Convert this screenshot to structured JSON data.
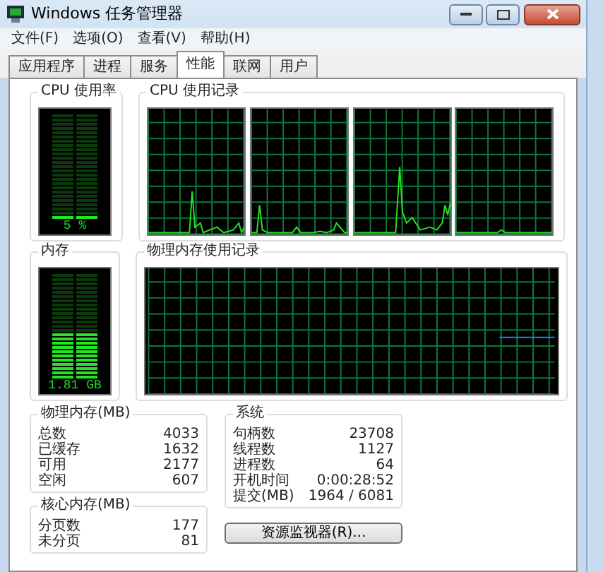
{
  "window": {
    "title": "Windows 任务管理器"
  },
  "menu": [
    "文件(F)",
    "选项(O)",
    "查看(V)",
    "帮助(H)"
  ],
  "tabs": [
    {
      "label": "应用程序",
      "selected": false
    },
    {
      "label": "进程",
      "selected": false
    },
    {
      "label": "服务",
      "selected": false
    },
    {
      "label": "性能",
      "selected": true
    },
    {
      "label": "联网",
      "selected": false
    },
    {
      "label": "用户",
      "selected": false
    }
  ],
  "cpu_usage": {
    "title": "CPU 使用率",
    "level": 0.05,
    "reading": "5 %"
  },
  "cpu_history": {
    "title": "CPU 使用记录"
  },
  "memory": {
    "title": "内存",
    "level": 0.45,
    "reading": "1.81 GB"
  },
  "memory_history": {
    "title": "物理内存使用记录"
  },
  "physical_memory": {
    "title": "物理内存(MB)",
    "rows": [
      {
        "label": "总数",
        "value": "4033"
      },
      {
        "label": "已缓存",
        "value": "1632"
      },
      {
        "label": "可用",
        "value": "2177"
      },
      {
        "label": "空闲",
        "value": "607"
      }
    ]
  },
  "kernel_memory": {
    "title": "核心内存(MB)",
    "rows": [
      {
        "label": "分页数",
        "value": "177"
      },
      {
        "label": "未分页",
        "value": "81"
      }
    ]
  },
  "system": {
    "title": "系统",
    "rows": [
      {
        "label": "句柄数",
        "value": "23708"
      },
      {
        "label": "线程数",
        "value": "1127"
      },
      {
        "label": "进程数",
        "value": "64"
      },
      {
        "label": "开机时间",
        "value": "0:00:28:52"
      },
      {
        "label": "提交(MB)",
        "value": "1964 / 6081"
      }
    ]
  },
  "buttons": [
    "资源监视器(R)..."
  ]
}
